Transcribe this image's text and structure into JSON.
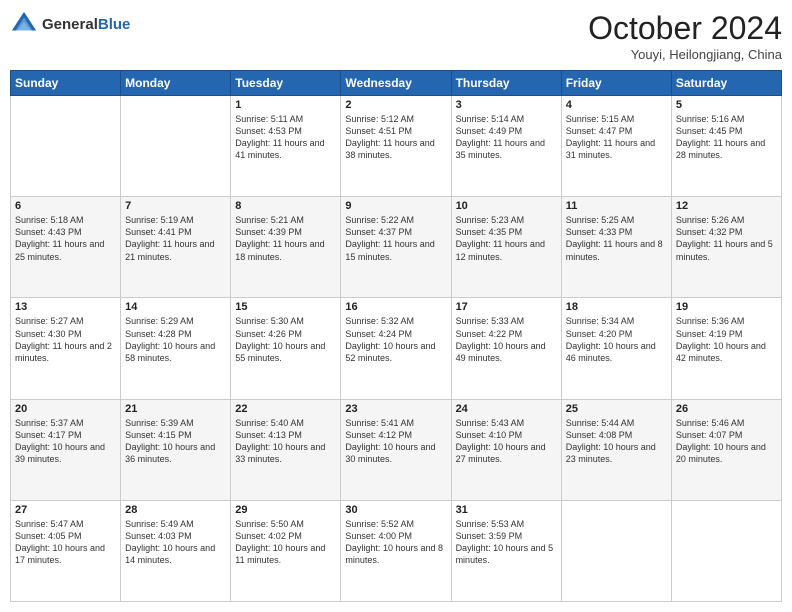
{
  "header": {
    "logo_general": "General",
    "logo_blue": "Blue",
    "month_title": "October 2024",
    "location": "Youyi, Heilongjiang, China"
  },
  "weekdays": [
    "Sunday",
    "Monday",
    "Tuesday",
    "Wednesday",
    "Thursday",
    "Friday",
    "Saturday"
  ],
  "weeks": [
    [
      {
        "day": "",
        "info": ""
      },
      {
        "day": "",
        "info": ""
      },
      {
        "day": "1",
        "info": "Sunrise: 5:11 AM\nSunset: 4:53 PM\nDaylight: 11 hours and 41 minutes."
      },
      {
        "day": "2",
        "info": "Sunrise: 5:12 AM\nSunset: 4:51 PM\nDaylight: 11 hours and 38 minutes."
      },
      {
        "day": "3",
        "info": "Sunrise: 5:14 AM\nSunset: 4:49 PM\nDaylight: 11 hours and 35 minutes."
      },
      {
        "day": "4",
        "info": "Sunrise: 5:15 AM\nSunset: 4:47 PM\nDaylight: 11 hours and 31 minutes."
      },
      {
        "day": "5",
        "info": "Sunrise: 5:16 AM\nSunset: 4:45 PM\nDaylight: 11 hours and 28 minutes."
      }
    ],
    [
      {
        "day": "6",
        "info": "Sunrise: 5:18 AM\nSunset: 4:43 PM\nDaylight: 11 hours and 25 minutes."
      },
      {
        "day": "7",
        "info": "Sunrise: 5:19 AM\nSunset: 4:41 PM\nDaylight: 11 hours and 21 minutes."
      },
      {
        "day": "8",
        "info": "Sunrise: 5:21 AM\nSunset: 4:39 PM\nDaylight: 11 hours and 18 minutes."
      },
      {
        "day": "9",
        "info": "Sunrise: 5:22 AM\nSunset: 4:37 PM\nDaylight: 11 hours and 15 minutes."
      },
      {
        "day": "10",
        "info": "Sunrise: 5:23 AM\nSunset: 4:35 PM\nDaylight: 11 hours and 12 minutes."
      },
      {
        "day": "11",
        "info": "Sunrise: 5:25 AM\nSunset: 4:33 PM\nDaylight: 11 hours and 8 minutes."
      },
      {
        "day": "12",
        "info": "Sunrise: 5:26 AM\nSunset: 4:32 PM\nDaylight: 11 hours and 5 minutes."
      }
    ],
    [
      {
        "day": "13",
        "info": "Sunrise: 5:27 AM\nSunset: 4:30 PM\nDaylight: 11 hours and 2 minutes."
      },
      {
        "day": "14",
        "info": "Sunrise: 5:29 AM\nSunset: 4:28 PM\nDaylight: 10 hours and 58 minutes."
      },
      {
        "day": "15",
        "info": "Sunrise: 5:30 AM\nSunset: 4:26 PM\nDaylight: 10 hours and 55 minutes."
      },
      {
        "day": "16",
        "info": "Sunrise: 5:32 AM\nSunset: 4:24 PM\nDaylight: 10 hours and 52 minutes."
      },
      {
        "day": "17",
        "info": "Sunrise: 5:33 AM\nSunset: 4:22 PM\nDaylight: 10 hours and 49 minutes."
      },
      {
        "day": "18",
        "info": "Sunrise: 5:34 AM\nSunset: 4:20 PM\nDaylight: 10 hours and 46 minutes."
      },
      {
        "day": "19",
        "info": "Sunrise: 5:36 AM\nSunset: 4:19 PM\nDaylight: 10 hours and 42 minutes."
      }
    ],
    [
      {
        "day": "20",
        "info": "Sunrise: 5:37 AM\nSunset: 4:17 PM\nDaylight: 10 hours and 39 minutes."
      },
      {
        "day": "21",
        "info": "Sunrise: 5:39 AM\nSunset: 4:15 PM\nDaylight: 10 hours and 36 minutes."
      },
      {
        "day": "22",
        "info": "Sunrise: 5:40 AM\nSunset: 4:13 PM\nDaylight: 10 hours and 33 minutes."
      },
      {
        "day": "23",
        "info": "Sunrise: 5:41 AM\nSunset: 4:12 PM\nDaylight: 10 hours and 30 minutes."
      },
      {
        "day": "24",
        "info": "Sunrise: 5:43 AM\nSunset: 4:10 PM\nDaylight: 10 hours and 27 minutes."
      },
      {
        "day": "25",
        "info": "Sunrise: 5:44 AM\nSunset: 4:08 PM\nDaylight: 10 hours and 23 minutes."
      },
      {
        "day": "26",
        "info": "Sunrise: 5:46 AM\nSunset: 4:07 PM\nDaylight: 10 hours and 20 minutes."
      }
    ],
    [
      {
        "day": "27",
        "info": "Sunrise: 5:47 AM\nSunset: 4:05 PM\nDaylight: 10 hours and 17 minutes."
      },
      {
        "day": "28",
        "info": "Sunrise: 5:49 AM\nSunset: 4:03 PM\nDaylight: 10 hours and 14 minutes."
      },
      {
        "day": "29",
        "info": "Sunrise: 5:50 AM\nSunset: 4:02 PM\nDaylight: 10 hours and 11 minutes."
      },
      {
        "day": "30",
        "info": "Sunrise: 5:52 AM\nSunset: 4:00 PM\nDaylight: 10 hours and 8 minutes."
      },
      {
        "day": "31",
        "info": "Sunrise: 5:53 AM\nSunset: 3:59 PM\nDaylight: 10 hours and 5 minutes."
      },
      {
        "day": "",
        "info": ""
      },
      {
        "day": "",
        "info": ""
      }
    ]
  ]
}
